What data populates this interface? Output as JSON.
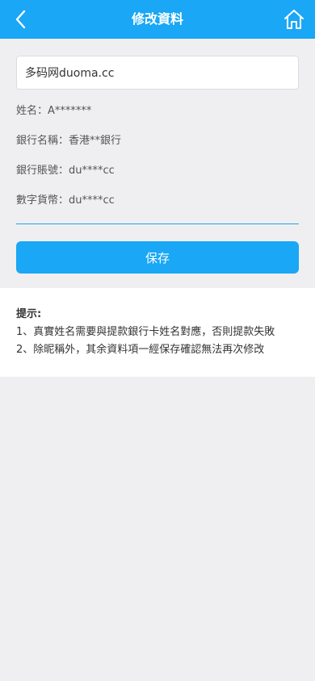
{
  "header": {
    "title": "修改資料",
    "back_icon": "chevron-left-icon",
    "home_icon": "home-icon",
    "background_color": "#1aa7f5"
  },
  "form": {
    "name_input_value": "多码网duoma.cc",
    "info": [
      {
        "label": "姓名：",
        "value": "A*******"
      },
      {
        "label": "銀行名稱：",
        "value": "香港**銀行"
      },
      {
        "label": "銀行賬號：",
        "value": "du****cc"
      },
      {
        "label": "數字貨幣：",
        "value": "du****cc"
      }
    ],
    "save_label": "保存"
  },
  "tips": {
    "title": "提示:",
    "lines": [
      "1、真實姓名需要與提款銀行卡姓名對應，否則提款失敗",
      "2、除昵稱外，其余資料項一經保存確認無法再次修改"
    ]
  }
}
